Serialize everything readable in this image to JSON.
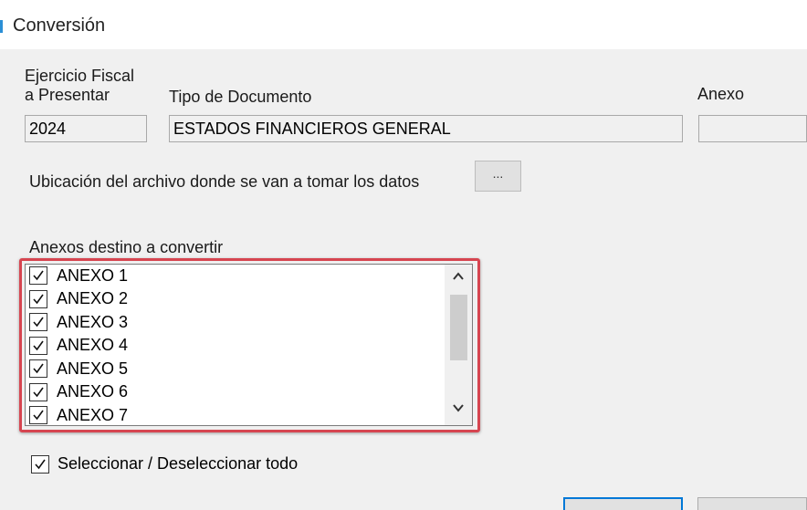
{
  "window": {
    "title": "Conversión"
  },
  "form": {
    "ejercicio_label_line1": "Ejercicio Fiscal",
    "ejercicio_label_line2": "a Presentar",
    "ejercicio_value": "2024",
    "tipo_label": "Tipo de Documento",
    "tipo_value": "ESTADOS FINANCIEROS GENERAL",
    "anexo_label": "Anexo",
    "anexo_value": "",
    "ubicacion_label": "Ubicación del archivo donde se van a tomar los datos",
    "browse_label": "...",
    "anexos_label": "Anexos destino a convertir"
  },
  "anexos": [
    {
      "label": "ANEXO 1",
      "checked": true
    },
    {
      "label": "ANEXO 2",
      "checked": true
    },
    {
      "label": "ANEXO 3",
      "checked": true
    },
    {
      "label": "ANEXO 4",
      "checked": true
    },
    {
      "label": "ANEXO 5",
      "checked": true
    },
    {
      "label": "ANEXO 6",
      "checked": true
    },
    {
      "label": "ANEXO 7",
      "checked": true
    }
  ],
  "select_all": {
    "label": "Seleccionar / Deseleccionar todo",
    "checked": true
  },
  "colors": {
    "highlight": "#d64550",
    "title_accent": "#2b8fd6",
    "ok_border": "#0078d7"
  },
  "icons": {
    "scroll_up": "chevron-up-icon",
    "scroll_down": "chevron-down-icon",
    "check": "checkmark-icon"
  }
}
